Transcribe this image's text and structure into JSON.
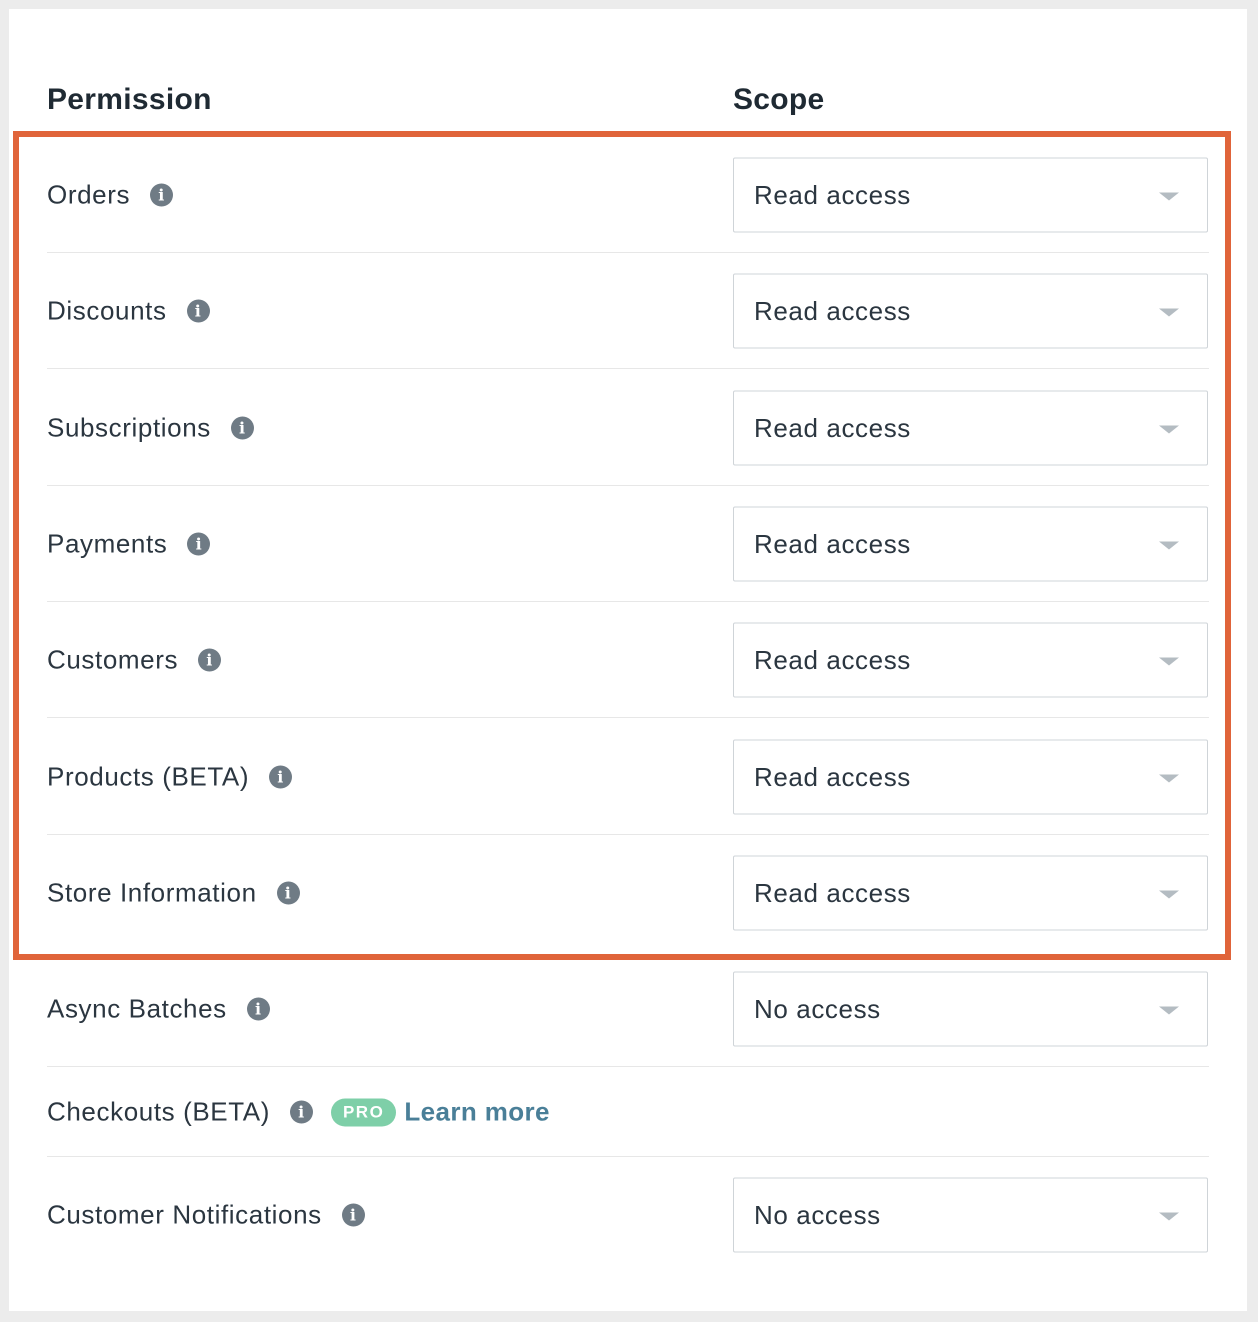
{
  "headers": {
    "permission": "Permission",
    "scope": "Scope"
  },
  "rows": [
    {
      "label": "Orders",
      "scope": "Read access"
    },
    {
      "label": "Discounts",
      "scope": "Read access"
    },
    {
      "label": "Subscriptions",
      "scope": "Read access"
    },
    {
      "label": "Payments",
      "scope": "Read access"
    },
    {
      "label": "Customers",
      "scope": "Read access"
    },
    {
      "label": "Products (BETA)",
      "scope": "Read access"
    },
    {
      "label": "Store Information",
      "scope": "Read access"
    },
    {
      "label": "Async Batches",
      "scope": "No access"
    },
    {
      "label": "Checkouts (BETA)",
      "badge": "PRO",
      "link": "Learn more"
    },
    {
      "label": "Customer Notifications",
      "scope": "No access"
    }
  ],
  "icons": {
    "info": "info-circle-icon",
    "dropdown": "caret-down-icon"
  },
  "colors": {
    "highlight_border": "#e0643a",
    "pro_badge": "#7ecfa8",
    "link": "#4a7f98"
  }
}
